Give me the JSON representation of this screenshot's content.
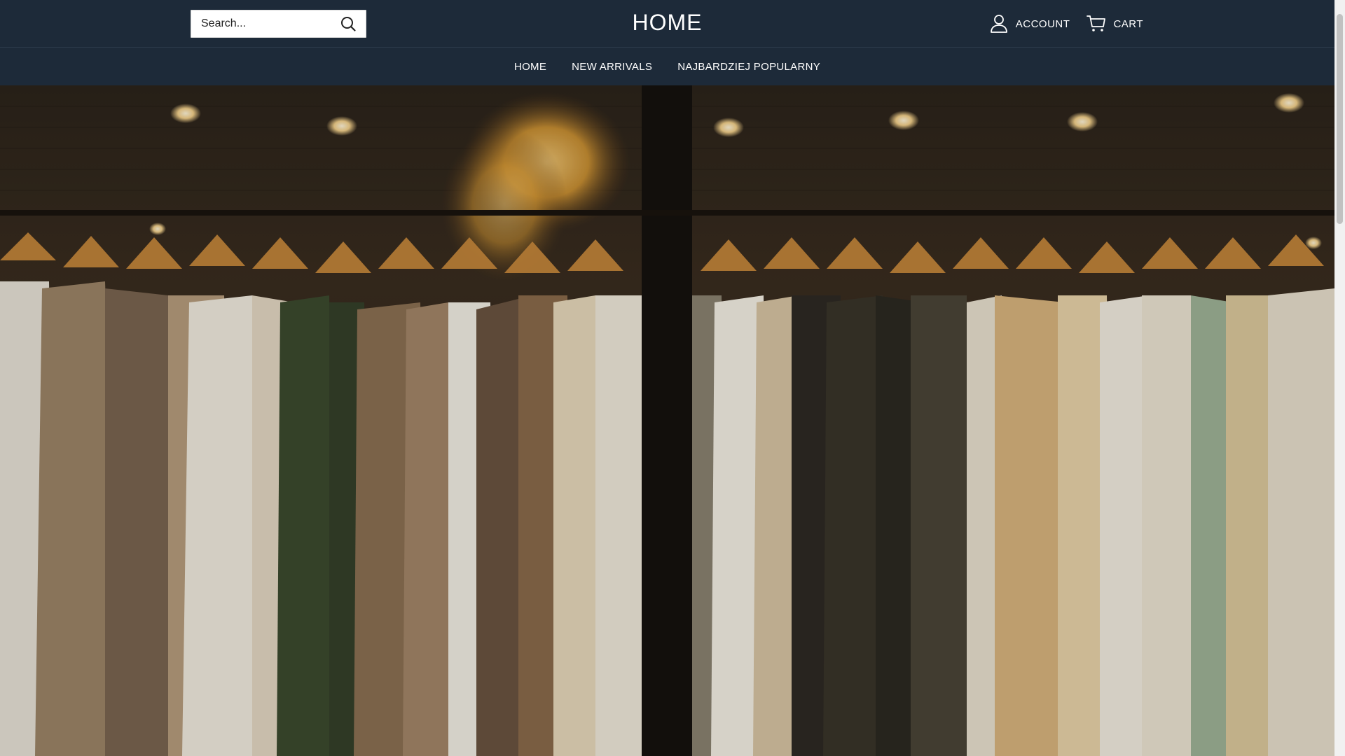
{
  "search": {
    "placeholder": "Search..."
  },
  "site_title": "HOME",
  "header_links": {
    "account_label": "ACCOUNT",
    "cart_label": "CART"
  },
  "nav": {
    "items": [
      {
        "label": "HOME"
      },
      {
        "label": "NEW ARRIVALS"
      },
      {
        "label": "NAJBARDZIEJ POPULARNY"
      }
    ]
  },
  "icons": {
    "search": "search-icon",
    "account": "user-icon",
    "cart": "cart-icon"
  },
  "colors": {
    "header_bg": "#1d2a39",
    "header_text": "#ffffff"
  }
}
